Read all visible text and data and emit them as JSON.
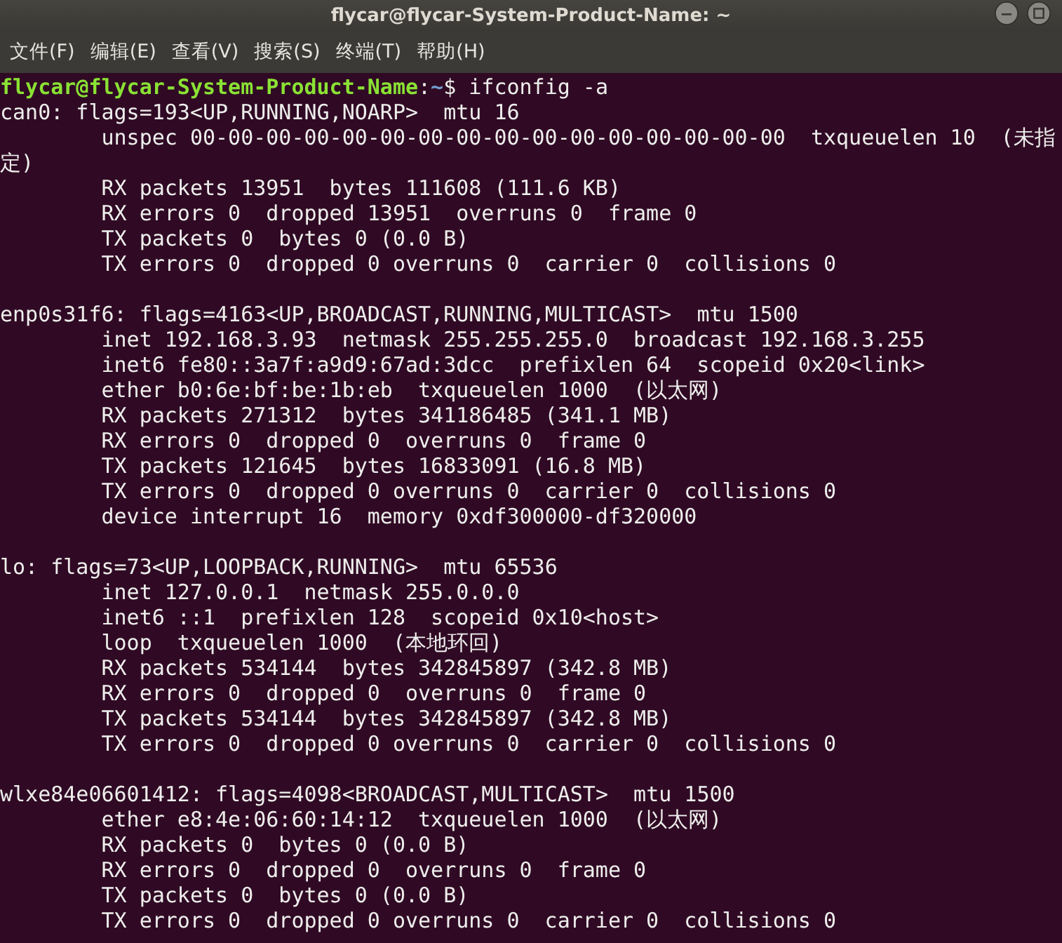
{
  "window": {
    "title": "flycar@flycar-System-Product-Name: ~",
    "controls": [
      {
        "kind": "minimize"
      },
      {
        "kind": "maximize"
      }
    ]
  },
  "menu": [
    "文件(F)",
    "编辑(E)",
    "查看(V)",
    "搜索(S)",
    "终端(T)",
    "帮助(H)"
  ],
  "prompt": {
    "user_host": "flycar@flycar-System-Product-Name",
    "separator": ":",
    "path": "~",
    "symbol": "$",
    "command": "ifconfig -a"
  },
  "interfaces": [
    {
      "header": "can0: flags=193<UP,RUNNING,NOARP>  mtu 16",
      "lines": [
        {
          "text": "unspec 00-00-00-00-00-00-00-00-00-00-00-00-00-00-00-00  txqueuelen 10  (未指",
          "indented": true
        },
        {
          "text": "定)",
          "indented": false
        },
        {
          "text": "RX packets 13951  bytes 111608 (111.6 KB)",
          "indented": true
        },
        {
          "text": "RX errors 0  dropped 13951  overruns 0  frame 0",
          "indented": true
        },
        {
          "text": "TX packets 0  bytes 0 (0.0 B)",
          "indented": true
        },
        {
          "text": "TX errors 0  dropped 0 overruns 0  carrier 0  collisions 0",
          "indented": true
        }
      ]
    },
    {
      "header": "enp0s31f6: flags=4163<UP,BROADCAST,RUNNING,MULTICAST>  mtu 1500",
      "lines": [
        {
          "text": "inet 192.168.3.93  netmask 255.255.255.0  broadcast 192.168.3.255",
          "indented": true
        },
        {
          "text": "inet6 fe80::3a7f:a9d9:67ad:3dcc  prefixlen 64  scopeid 0x20<link>",
          "indented": true
        },
        {
          "text": "ether b0:6e:bf:be:1b:eb  txqueuelen 1000  (以太网)",
          "indented": true
        },
        {
          "text": "RX packets 271312  bytes 341186485 (341.1 MB)",
          "indented": true
        },
        {
          "text": "RX errors 0  dropped 0  overruns 0  frame 0",
          "indented": true
        },
        {
          "text": "TX packets 121645  bytes 16833091 (16.8 MB)",
          "indented": true
        },
        {
          "text": "TX errors 0  dropped 0 overruns 0  carrier 0  collisions 0",
          "indented": true
        },
        {
          "text": "device interrupt 16  memory 0xdf300000-df320000",
          "indented": true
        }
      ]
    },
    {
      "header": "lo: flags=73<UP,LOOPBACK,RUNNING>  mtu 65536",
      "lines": [
        {
          "text": "inet 127.0.0.1  netmask 255.0.0.0",
          "indented": true
        },
        {
          "text": "inet6 ::1  prefixlen 128  scopeid 0x10<host>",
          "indented": true
        },
        {
          "text": "loop  txqueuelen 1000  (本地环回)",
          "indented": true
        },
        {
          "text": "RX packets 534144  bytes 342845897 (342.8 MB)",
          "indented": true
        },
        {
          "text": "RX errors 0  dropped 0  overruns 0  frame 0",
          "indented": true
        },
        {
          "text": "TX packets 534144  bytes 342845897 (342.8 MB)",
          "indented": true
        },
        {
          "text": "TX errors 0  dropped 0 overruns 0  carrier 0  collisions 0",
          "indented": true
        }
      ]
    },
    {
      "header": "wlxe84e06601412: flags=4098<BROADCAST,MULTICAST>  mtu 1500",
      "lines": [
        {
          "text": "ether e8:4e:06:60:14:12  txqueuelen 1000  (以太网)",
          "indented": true
        },
        {
          "text": "RX packets 0  bytes 0 (0.0 B)",
          "indented": true
        },
        {
          "text": "RX errors 0  dropped 0  overruns 0  frame 0",
          "indented": true
        },
        {
          "text": "TX packets 0  bytes 0 (0.0 B)",
          "indented": true
        },
        {
          "text": "TX errors 0  dropped 0 overruns 0  carrier 0  collisions 0",
          "indented": true
        }
      ]
    }
  ]
}
